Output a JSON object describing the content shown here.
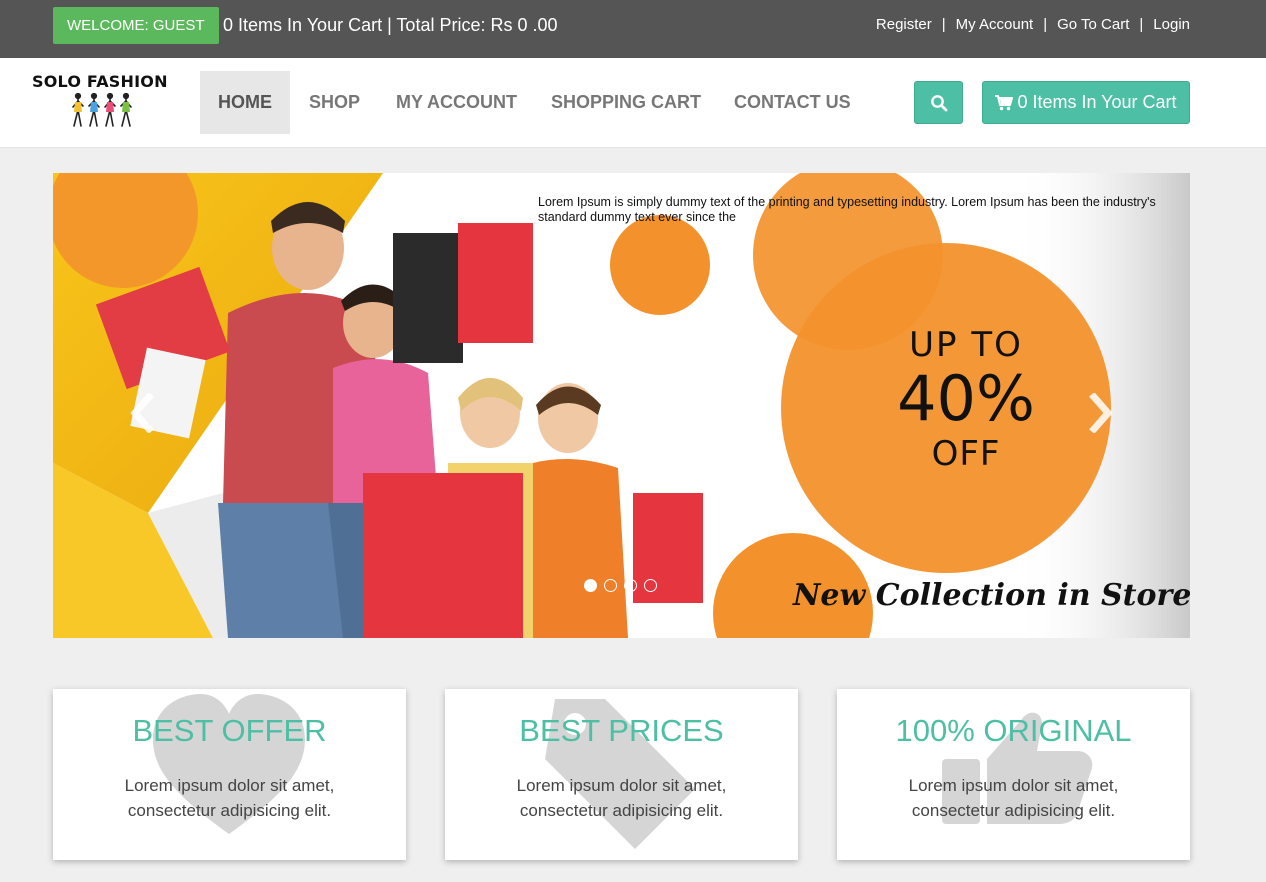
{
  "topbar": {
    "welcome": "WELCOME: GUEST",
    "cart_summary": "0 Items In Your Cart | Total Price: Rs 0 .00",
    "links": [
      "Register",
      "My Account",
      "Go To Cart",
      "Login"
    ],
    "separator": "|"
  },
  "brand": {
    "name": "SOLO FASHION"
  },
  "nav": {
    "items": [
      "HOME",
      "SHOP",
      "MY ACCOUNT",
      "SHOPPING CART",
      "CONTACT US"
    ],
    "active": "HOME",
    "search_icon": "search-icon",
    "cart_button": "0 Items In Your Cart",
    "cart_icon": "shopping-cart-icon"
  },
  "carousel": {
    "caption": "Lorem Ipsum is simply dummy text of the printing and typesetting industry. Lorem Ipsum has been the industry's standard dummy text ever since the",
    "promo_line1": "UP TO",
    "promo_line2": "40%",
    "promo_line3": "OFF",
    "tagline": "New Collection in Store",
    "slide_count": 4,
    "active_slide": 1,
    "prev_icon": "chevron-left-icon",
    "next_icon": "chevron-right-icon"
  },
  "features": [
    {
      "title": "BEST OFFER",
      "text_line1": "Lorem ipsum dolor sit amet,",
      "text_line2": "consectetur adipisicing elit.",
      "icon": "heart-icon"
    },
    {
      "title": "BEST PRICES",
      "text_line1": "Lorem ipsum dolor sit amet,",
      "text_line2": "consectetur adipisicing elit.",
      "icon": "tag-icon"
    },
    {
      "title": "100% ORIGINAL",
      "text_line1": "Lorem ipsum dolor sit amet,",
      "text_line2": "consectetur adipisicing elit.",
      "icon": "thumbs-up-icon"
    }
  ],
  "colors": {
    "topbar": "#555555",
    "accent": "#4dbfa4",
    "welcome": "#5cb85c",
    "promo_orange": "#f3922c",
    "banner_yellow": "#f6c317"
  }
}
